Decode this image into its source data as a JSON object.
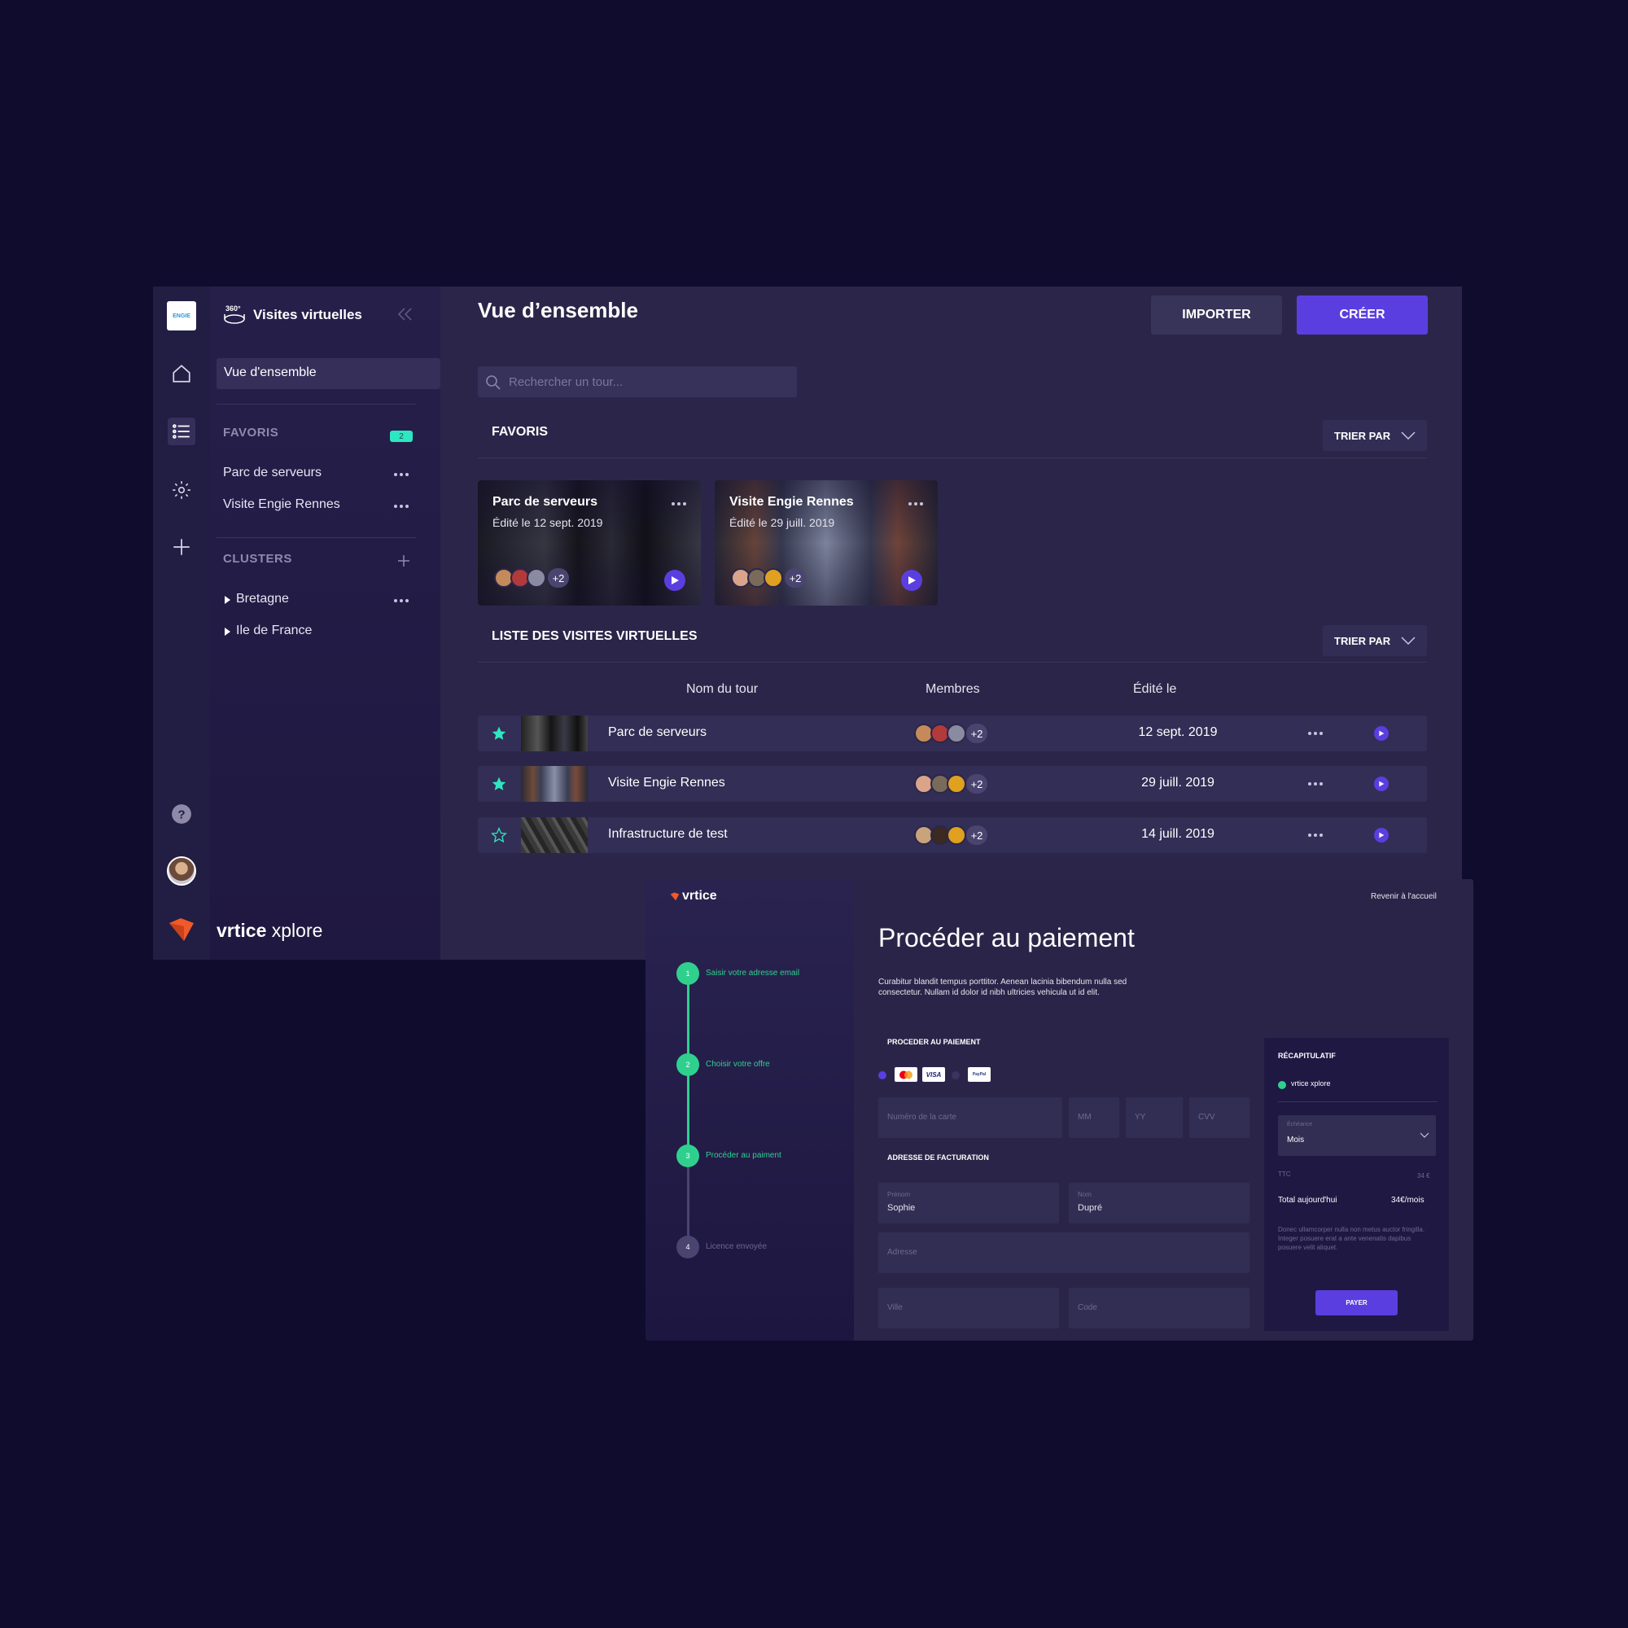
{
  "app": {
    "section_title": "Visites virtuelles",
    "brand_name": "vrtice",
    "brand_suffix": " xplore",
    "logo_text": "ENGIE",
    "sidebar": {
      "active_item": "Vue d'ensemble",
      "favorites_label": "FAVORIS",
      "favorites_count": "2",
      "favorites": [
        "Parc de serveurs",
        "Visite Engie Rennes"
      ],
      "clusters_label": "CLUSTERS",
      "clusters": [
        "Bretagne",
        "Ile de France"
      ]
    },
    "header": {
      "title": "Vue d’ensemble",
      "import_label": "IMPORTER",
      "create_label": "CRÉER"
    },
    "search": {
      "placeholder": "Rechercher un tour..."
    },
    "favorites_section": {
      "title": "FAVORIS",
      "sort_label": "TRIER PAR",
      "cards": [
        {
          "title": "Parc de serveurs",
          "subtitle": "Édité le 12 sept. 2019",
          "extra": "+2"
        },
        {
          "title": "Visite Engie Rennes",
          "subtitle": "Édité le 29 juill. 2019",
          "extra": "+2"
        }
      ]
    },
    "list_section": {
      "title": "LISTE DES VISITES VIRTUELLES",
      "sort_label": "TRIER PAR",
      "columns": [
        "Nom du tour",
        "Membres",
        "Édité le"
      ],
      "rows": [
        {
          "name": "Parc de serveurs",
          "members_extra": "+2",
          "date": "12 sept. 2019",
          "favorite": true
        },
        {
          "name": "Visite Engie Rennes",
          "members_extra": "+2",
          "date": "29 juill. 2019",
          "favorite": true
        },
        {
          "name": "Infrastructure de test",
          "members_extra": "+2",
          "date": "14 juill. 2019",
          "favorite": false
        }
      ]
    },
    "colors": {
      "accent": "#5b3ee0",
      "teal": "#2ee6c1",
      "background": "#0f0c2e"
    }
  },
  "payment": {
    "brand": "vrtice",
    "back_link": "Revenir à l'accueil",
    "title": "Procéder au paiement",
    "description": "Curabitur blandit tempus porttitor. Aenean lacinia bibendum nulla sed consectetur. Nullam id dolor id nibh ultricies vehicula ut id elit.",
    "steps": [
      {
        "num": "1",
        "label": "Saisir votre adresse email"
      },
      {
        "num": "2",
        "label": "Choisir votre offre"
      },
      {
        "num": "3",
        "label": "Procéder au paiment"
      },
      {
        "num": "4",
        "label": "Licence envoyée"
      }
    ],
    "payment_section": "PROCEDER AU PAIEMENT",
    "card_logos": [
      "VISA",
      "PayPal"
    ],
    "card_fields": [
      "Numéro de la carte",
      "MM",
      "YY",
      "CVV"
    ],
    "billing_section": "ADRESSE DE FACTURATION",
    "billing": {
      "first_name_label": "Prénom",
      "first_name": "Sophie",
      "last_name_label": "Nom",
      "last_name": "Dupré",
      "address": "Adresse",
      "city": "Ville",
      "code": "Code"
    },
    "summary": {
      "title": "RÉCAPITULATIF",
      "product": "vrtice xplore",
      "schedule_label": "Échéance",
      "schedule_value": "Mois",
      "ttc_label": "TTC",
      "ttc_value": "34 €",
      "total_label": "Total aujourd'hui",
      "total_value": "34€/mois",
      "note": "Donec ullamcorper nulla non metus auctor fringilla. Integer posuere erat a ante venenatis dapibus posuere velit aliquet.",
      "pay_label": "PAYER"
    }
  }
}
